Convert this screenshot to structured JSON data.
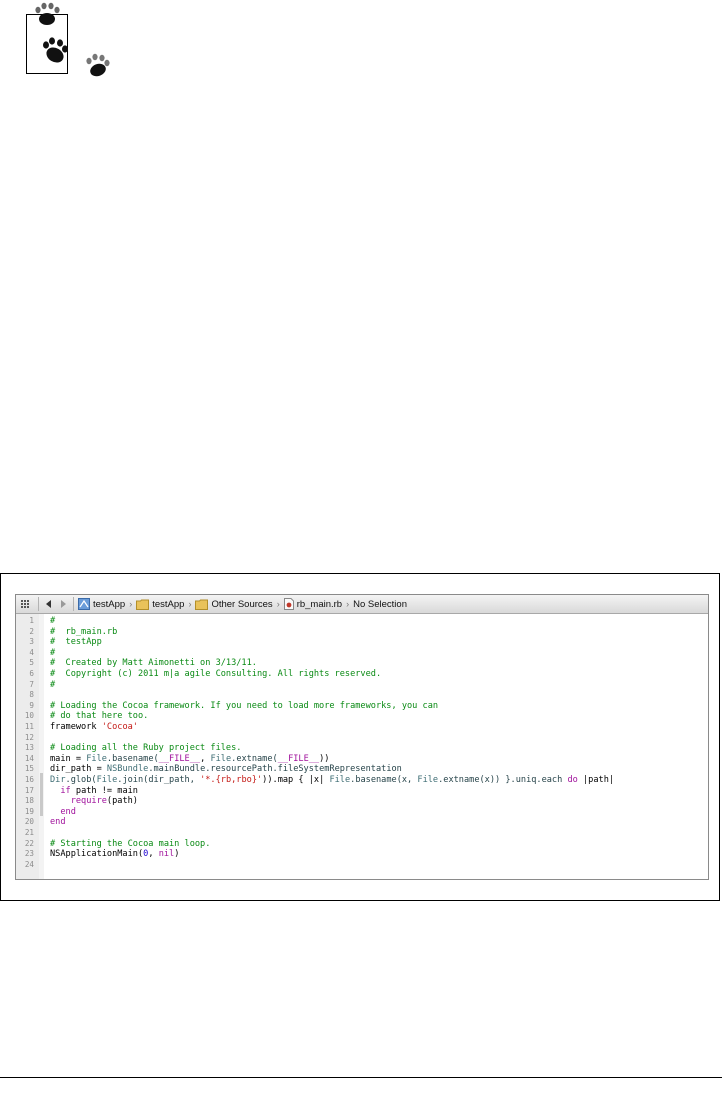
{
  "jumpbar": {
    "crumbs": [
      {
        "label": "testApp",
        "icon": "xcode-project-icon"
      },
      {
        "label": "testApp",
        "icon": "folder-icon"
      },
      {
        "label": "Other Sources",
        "icon": "folder-icon"
      },
      {
        "label": "rb_main.rb",
        "icon": "ruby-file-icon"
      },
      {
        "label": "No Selection",
        "icon": ""
      }
    ]
  },
  "editor": {
    "lines": [
      {
        "n": "1",
        "tokens": [
          {
            "t": "#",
            "c": "comment"
          }
        ]
      },
      {
        "n": "2",
        "tokens": [
          {
            "t": "#  rb_main.rb",
            "c": "comment"
          }
        ]
      },
      {
        "n": "3",
        "tokens": [
          {
            "t": "#  testApp",
            "c": "comment"
          }
        ]
      },
      {
        "n": "4",
        "tokens": [
          {
            "t": "#",
            "c": "comment"
          }
        ]
      },
      {
        "n": "5",
        "tokens": [
          {
            "t": "#  Created by Matt Aimonetti on 3/13/11.",
            "c": "comment"
          }
        ]
      },
      {
        "n": "6",
        "tokens": [
          {
            "t": "#  Copyright (c) 2011 m|a agile Consulting. All rights reserved.",
            "c": "comment"
          }
        ]
      },
      {
        "n": "7",
        "tokens": [
          {
            "t": "#",
            "c": "comment"
          }
        ]
      },
      {
        "n": "8",
        "tokens": []
      },
      {
        "n": "9",
        "tokens": [
          {
            "t": "# Loading the Cocoa framework. If you need to load more frameworks, you can",
            "c": "comment"
          }
        ]
      },
      {
        "n": "10",
        "tokens": [
          {
            "t": "# do that here too.",
            "c": "comment"
          }
        ]
      },
      {
        "n": "11",
        "tokens": [
          {
            "t": "framework ",
            "c": "plain"
          },
          {
            "t": "'Cocoa'",
            "c": "string"
          }
        ]
      },
      {
        "n": "12",
        "tokens": []
      },
      {
        "n": "13",
        "tokens": [
          {
            "t": "# Loading all the Ruby project files.",
            "c": "comment"
          }
        ]
      },
      {
        "n": "14",
        "tokens": [
          {
            "t": "main = ",
            "c": "plain"
          },
          {
            "t": "File",
            "c": "class"
          },
          {
            "t": ".basename(",
            "c": "method"
          },
          {
            "t": "__FILE__",
            "c": "keyword"
          },
          {
            "t": ", ",
            "c": "plain"
          },
          {
            "t": "File",
            "c": "class"
          },
          {
            "t": ".extname(",
            "c": "method"
          },
          {
            "t": "__FILE__",
            "c": "keyword"
          },
          {
            "t": "))",
            "c": "plain"
          }
        ]
      },
      {
        "n": "15",
        "tokens": [
          {
            "t": "dir_path = ",
            "c": "plain"
          },
          {
            "t": "NSBundle",
            "c": "class"
          },
          {
            "t": ".mainBundle.resourcePath.fileSystemRepresentation",
            "c": "method"
          }
        ]
      },
      {
        "n": "16",
        "tokens": [
          {
            "t": "Dir",
            "c": "class"
          },
          {
            "t": ".glob(",
            "c": "method"
          },
          {
            "t": "File",
            "c": "class"
          },
          {
            "t": ".join(dir_path, ",
            "c": "method"
          },
          {
            "t": "'*.{rb,rbo}'",
            "c": "string"
          },
          {
            "t": ")).map { |x| ",
            "c": "plain"
          },
          {
            "t": "File",
            "c": "class"
          },
          {
            "t": ".basename(x, ",
            "c": "method"
          },
          {
            "t": "File",
            "c": "class"
          },
          {
            "t": ".extname(x)) }.uniq.each ",
            "c": "method"
          },
          {
            "t": "do",
            "c": "keyword"
          },
          {
            "t": " |path|",
            "c": "plain"
          }
        ]
      },
      {
        "n": "17",
        "tokens": [
          {
            "t": "  ",
            "c": "plain"
          },
          {
            "t": "if",
            "c": "keyword"
          },
          {
            "t": " path != main",
            "c": "plain"
          }
        ]
      },
      {
        "n": "18",
        "tokens": [
          {
            "t": "    ",
            "c": "plain"
          },
          {
            "t": "require",
            "c": "keyword"
          },
          {
            "t": "(path)",
            "c": "plain"
          }
        ]
      },
      {
        "n": "19",
        "tokens": [
          {
            "t": "  ",
            "c": "plain"
          },
          {
            "t": "end",
            "c": "keyword"
          }
        ]
      },
      {
        "n": "20",
        "tokens": [
          {
            "t": "end",
            "c": "keyword"
          }
        ]
      },
      {
        "n": "21",
        "tokens": []
      },
      {
        "n": "22",
        "tokens": [
          {
            "t": "# Starting the Cocoa main loop.",
            "c": "comment"
          }
        ]
      },
      {
        "n": "23",
        "tokens": [
          {
            "t": "NSApplicationMain(",
            "c": "plain"
          },
          {
            "t": "0",
            "c": "number"
          },
          {
            "t": ", ",
            "c": "plain"
          },
          {
            "t": "nil",
            "c": "keyword"
          },
          {
            "t": ")",
            "c": "plain"
          }
        ]
      },
      {
        "n": "24",
        "tokens": []
      }
    ]
  }
}
